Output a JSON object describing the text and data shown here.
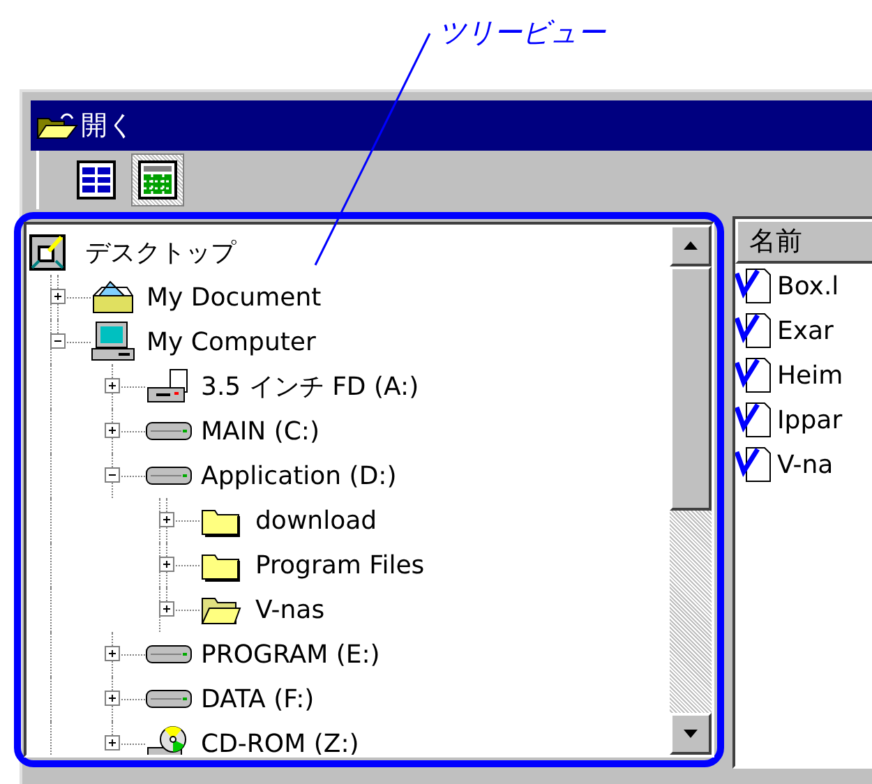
{
  "annotation": {
    "label": "ツリービュー"
  },
  "window": {
    "title": "開く"
  },
  "toolbar": {
    "buttons": [
      {
        "kind": "list",
        "selected": false
      },
      {
        "kind": "details",
        "selected": true
      }
    ]
  },
  "tree": [
    {
      "label": "デスクトップ",
      "kind": "desktop",
      "children": [
        {
          "label": "My Document",
          "kind": "documents",
          "expanded": false
        },
        {
          "label": "My Computer",
          "kind": "computer",
          "expanded": true,
          "children": [
            {
              "label": "3.5 インチ FD (A:)",
              "kind": "floppy",
              "expanded": false
            },
            {
              "label": "MAIN (C:)",
              "kind": "drive",
              "expanded": false
            },
            {
              "label": "Application (D:)",
              "kind": "drive",
              "expanded": true,
              "children": [
                {
                  "label": "download",
                  "kind": "folder",
                  "expanded": false
                },
                {
                  "label": "Program Files",
                  "kind": "folder",
                  "expanded": false
                },
                {
                  "label": "V-nas",
                  "kind": "folder-open",
                  "expanded": false
                }
              ]
            },
            {
              "label": "PROGRAM (E:)",
              "kind": "drive",
              "expanded": false
            },
            {
              "label": "DATA (F:)",
              "kind": "drive",
              "expanded": false
            },
            {
              "label": "CD-ROM (Z:)",
              "kind": "cdrom",
              "expanded": false
            }
          ]
        }
      ]
    }
  ],
  "list": {
    "column_header": "名前",
    "items": [
      {
        "label": "Box.l"
      },
      {
        "label": "Exar"
      },
      {
        "label": "Heim"
      },
      {
        "label": "Ippar"
      },
      {
        "label": "V-na"
      }
    ]
  }
}
